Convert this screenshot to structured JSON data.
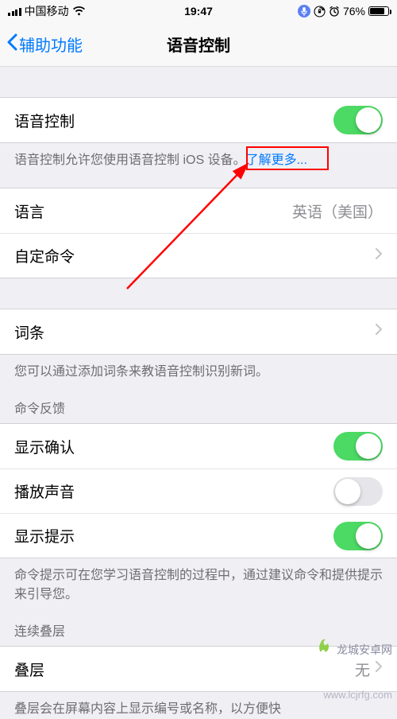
{
  "status": {
    "carrier": "中国移动",
    "time": "19:47",
    "battery_pct": "76%"
  },
  "nav": {
    "back_label": "辅助功能",
    "title": "语音控制"
  },
  "group1": {
    "voice_control_label": "语音控制",
    "footer_pre": "语音控制允许您使用语音控制 iOS 设备",
    "footer_sep": "。",
    "footer_link": "了解更多..."
  },
  "group2": {
    "language_label": "语言",
    "language_value": "英语（美国）",
    "custom_cmd_label": "自定命令"
  },
  "group3": {
    "vocab_label": "词条",
    "footer": "您可以通过添加词条来教语音控制识别新词。"
  },
  "group4": {
    "header": "命令反馈",
    "show_confirm_label": "显示确认",
    "play_sound_label": "播放声音",
    "show_hint_label": "显示提示",
    "footer": "命令提示可在您学习语音控制的过程中，通过建议命令和提供提示来引导您。"
  },
  "group5": {
    "header": "连续叠层",
    "overlay_label": "叠层",
    "overlay_value": "无",
    "footer": "叠层会在屏幕内容上显示编号或名称，以方便快"
  },
  "watermarks": {
    "site": "龙城安卓网",
    "url": "www.lcjrfg.com"
  }
}
